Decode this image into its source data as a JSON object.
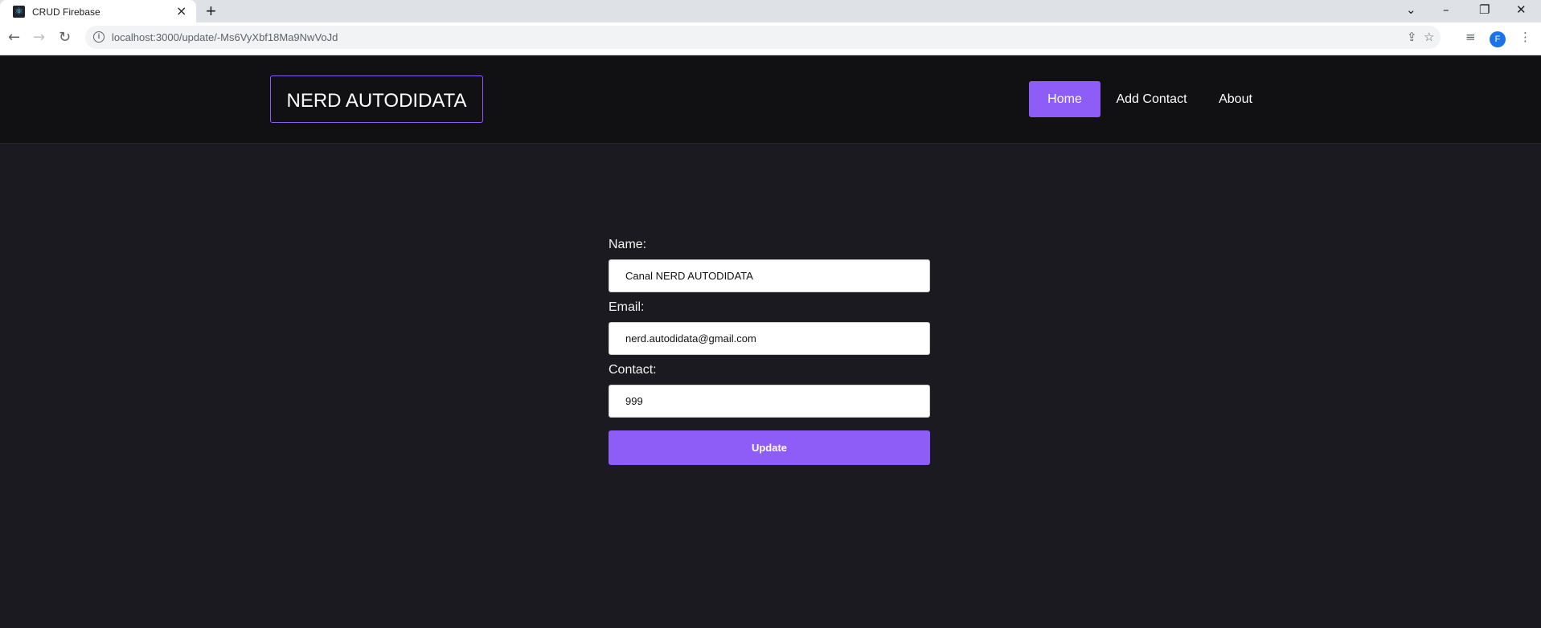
{
  "browser": {
    "tab_title": "CRUD Firebase",
    "url": "localhost:3000/update/-Ms6VyXbf18Ma9NwVoJd",
    "profile_initial": "F",
    "accent": "#1a73e8"
  },
  "navbar": {
    "brand": "NERD AUTODIDATA",
    "links": [
      {
        "label": "Home",
        "active": true
      },
      {
        "label": "Add Contact",
        "active": false
      },
      {
        "label": "About",
        "active": false
      }
    ],
    "accent": "#8e5cf7"
  },
  "form": {
    "name_label": "Name:",
    "name_value": "Canal NERD AUTODIDATA",
    "email_label": "Email:",
    "email_value": "nerd.autodidata@gmail.com",
    "contact_label": "Contact:",
    "contact_value": "999",
    "submit_label": "Update"
  },
  "icons": [
    "react-favicon-icon",
    "close-icon",
    "plus-icon",
    "chevron-down-icon",
    "minimize-icon",
    "restore-icon",
    "window-close-icon",
    "back-arrow-icon",
    "forward-arrow-icon",
    "reload-icon",
    "info-icon",
    "share-icon",
    "star-icon",
    "reading-list-icon",
    "kebab-menu-icon"
  ]
}
